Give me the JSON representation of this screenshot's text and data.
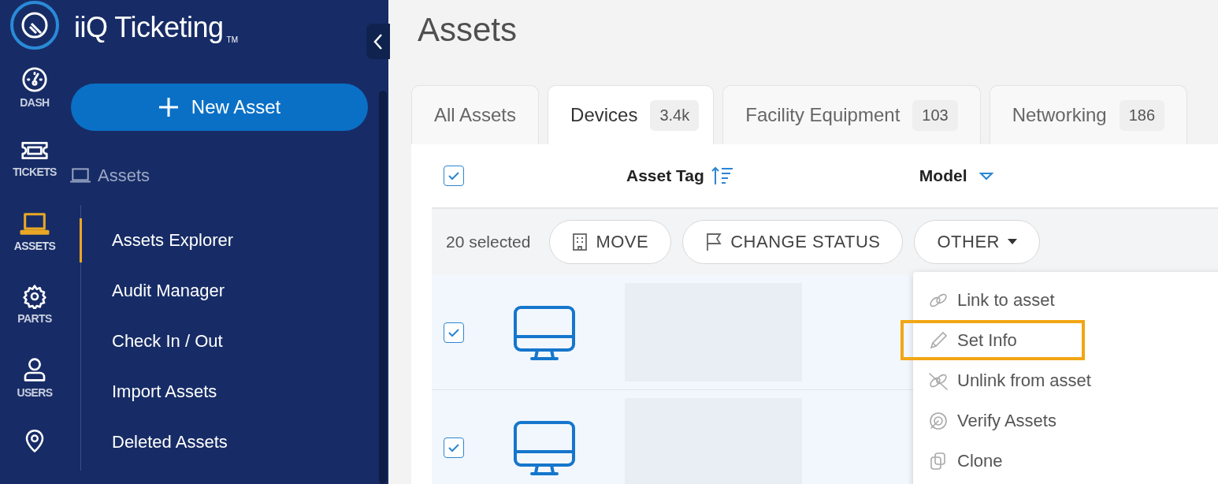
{
  "brand": {
    "name": "iiQ Ticketing",
    "mark": "TM"
  },
  "rail": [
    {
      "label": "DASH",
      "selected": false
    },
    {
      "label": "TICKETS",
      "selected": false
    },
    {
      "label": "ASSETS",
      "selected": true
    },
    {
      "label": "PARTS",
      "selected": false
    },
    {
      "label": "USERS",
      "selected": false
    },
    {
      "selected": false
    }
  ],
  "new_button": {
    "label": "New Asset"
  },
  "section": {
    "label": "Assets"
  },
  "subnav": [
    {
      "label": "Assets Explorer",
      "selected": true
    },
    {
      "label": "Audit Manager",
      "selected": false
    },
    {
      "label": "Check In / Out",
      "selected": false
    },
    {
      "label": "Import Assets",
      "selected": false
    },
    {
      "label": "Deleted Assets",
      "selected": false
    }
  ],
  "page_title": "Assets",
  "tabs": [
    {
      "label": "All Assets",
      "selected": false
    },
    {
      "label": "Devices",
      "count": "3.4k",
      "selected": true
    },
    {
      "label": "Facility Equipment",
      "count": "103",
      "selected": false
    },
    {
      "label": "Networking",
      "count": "186",
      "selected": false
    }
  ],
  "table": {
    "all_checked": true,
    "columns": [
      "Asset Tag",
      "Model"
    ],
    "selection": "20 selected",
    "actions": [
      "MOVE",
      "CHANGE STATUS",
      "OTHER"
    ],
    "rows": [
      {
        "checked": true
      },
      {
        "checked": true
      }
    ]
  },
  "menu": [
    {
      "label": "Link to asset",
      "highlighted": false
    },
    {
      "label": "Set Info",
      "highlighted": true
    },
    {
      "label": "Unlink from asset",
      "highlighted": false
    },
    {
      "label": "Verify Assets",
      "highlighted": false
    },
    {
      "label": "Clone",
      "highlighted": false
    }
  ]
}
